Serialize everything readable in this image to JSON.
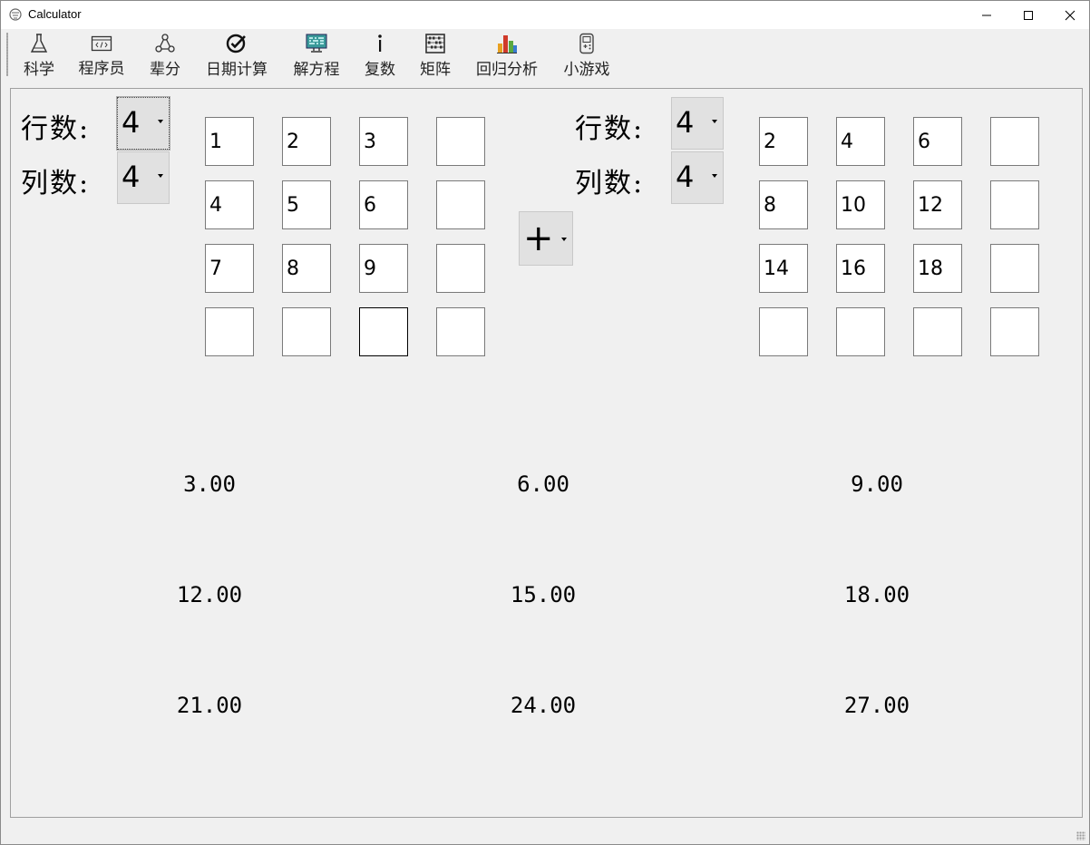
{
  "window": {
    "title": "Calculator"
  },
  "toolbar": {
    "items": [
      {
        "label": "科学",
        "icon": "flask-icon"
      },
      {
        "label": "程序员",
        "icon": "code-window-icon"
      },
      {
        "label": "辈分",
        "icon": "family-tree-icon"
      },
      {
        "label": "日期计算",
        "icon": "date-check-icon"
      },
      {
        "label": "解方程",
        "icon": "monitor-binary-icon"
      },
      {
        "label": "复数",
        "icon": "imaginary-i-icon"
      },
      {
        "label": "矩阵",
        "icon": "abacus-icon"
      },
      {
        "label": "回归分析",
        "icon": "bar-chart-icon"
      },
      {
        "label": "小游戏",
        "icon": "gamepad-icon"
      }
    ]
  },
  "matrix_a": {
    "rows_label": "行数:",
    "cols_label": "列数:",
    "rows_value": "4",
    "cols_value": "4",
    "cells": [
      [
        "1",
        "2",
        "3",
        ""
      ],
      [
        "4",
        "5",
        "6",
        ""
      ],
      [
        "7",
        "8",
        "9",
        ""
      ],
      [
        "",
        "",
        "",
        ""
      ]
    ]
  },
  "operator": {
    "value": "+"
  },
  "matrix_b": {
    "rows_label": "行数:",
    "cols_label": "列数:",
    "rows_value": "4",
    "cols_value": "4",
    "cells": [
      [
        "2",
        "4",
        "6",
        ""
      ],
      [
        "8",
        "10",
        "12",
        ""
      ],
      [
        "14",
        "16",
        "18",
        ""
      ],
      [
        "",
        "",
        "",
        ""
      ]
    ]
  },
  "result": {
    "cells": [
      [
        "3.00",
        "6.00",
        "9.00"
      ],
      [
        "12.00",
        "15.00",
        "18.00"
      ],
      [
        "21.00",
        "24.00",
        "27.00"
      ]
    ]
  }
}
